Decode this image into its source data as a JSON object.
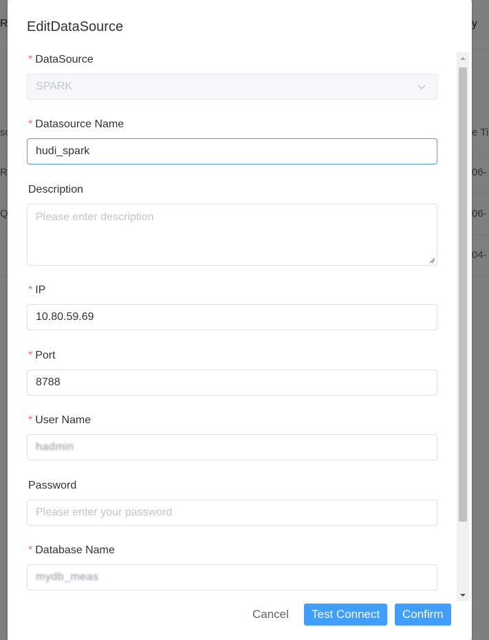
{
  "background": {
    "header_left": "Re",
    "header_right": "y",
    "col_left": "so",
    "col_right": "e Ti",
    "rows": [
      {
        "left": "RK",
        "right": "06-"
      },
      {
        "left": "Q",
        "right": "06-"
      },
      {
        "left": "",
        "right": "04-"
      }
    ]
  },
  "dialog": {
    "title": "EditDataSource",
    "fields": {
      "datasource": {
        "label": "DataSource",
        "required": "*",
        "value": "SPARK"
      },
      "name": {
        "label": "Datasource Name",
        "required": "*",
        "value": "hudi_spark"
      },
      "description": {
        "label": "Description",
        "placeholder": "Please enter description"
      },
      "ip": {
        "label": "IP",
        "required": "*",
        "value": "10.80.59.69"
      },
      "port": {
        "label": "Port",
        "required": "*",
        "value": "8788"
      },
      "username": {
        "label": "User Name",
        "required": "*",
        "value": "hadmin"
      },
      "password": {
        "label": "Password",
        "placeholder": "Please enter your password"
      },
      "database": {
        "label": "Database Name",
        "required": "*",
        "value": "mydb_meas"
      }
    },
    "buttons": {
      "cancel": "Cancel",
      "test_connect": "Test Connect",
      "confirm": "Confirm"
    }
  },
  "colors": {
    "primary": "#409eff",
    "required": "#f56c6c",
    "focus_border": "#409eff"
  },
  "icons": {
    "select_arrow": "chevron-down-icon",
    "textarea_resize": "resize-handle-icon",
    "scroll_up": "arrow-up-icon",
    "scroll_down": "arrow-down-icon"
  }
}
